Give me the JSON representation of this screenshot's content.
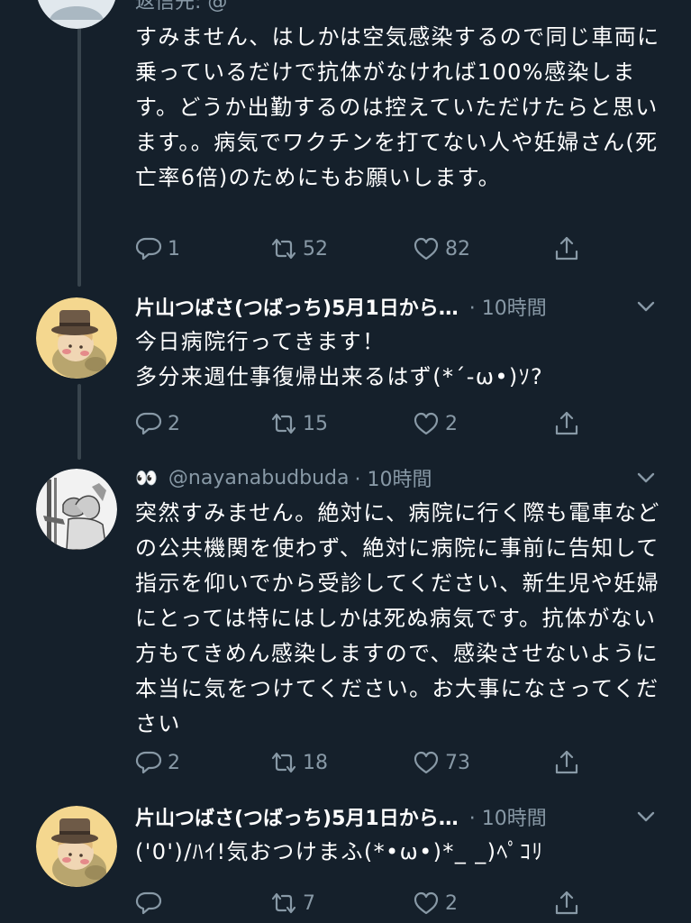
{
  "tweets": [
    {
      "partial_header": "返信先: @",
      "text": "すみません、はしかは空気感染するので同じ車両に乗っているだけで抗体がなければ100%感染します。どうか出勤するのは控えていただけたらと思います。。病気でワクチンを打てない人や妊婦さん(死亡率6倍)のためにもお願いします。",
      "reply_count": "1",
      "retweet_count": "52",
      "like_count": "82"
    },
    {
      "name": "片山つばさ(つばっち)5月1日から…",
      "time": "· 10時間",
      "text": "今日病院行ってきます！\n多分来週仕事復帰出来るはず(*´-ω•)ｿ?",
      "reply_count": "2",
      "retweet_count": "15",
      "like_count": "2"
    },
    {
      "name": "👀",
      "handle": "@nayanabudbuda",
      "time": "· 10時間",
      "text": "突然すみません。絶対に、病院に行く際も電車などの公共機関を使わず、絶対に病院に事前に告知して指示を仰いでから受診してください、新生児や妊婦にとっては特にはしかは死ぬ病気です。抗体がない方もてきめん感染しますので、感染させないように本当に気をつけてください。お大事になさってください",
      "reply_count": "2",
      "retweet_count": "18",
      "like_count": "73"
    },
    {
      "name": "片山つばさ(つばっち)5月1日から…",
      "time": "· 10時間",
      "text": "('0')/ﾊｲ!気おつけまふ(*•ω•)*_ _)ﾍﾟｺﾘ",
      "reply_count": "",
      "retweet_count": "7",
      "like_count": "2"
    }
  ],
  "icons": {
    "reply": "reply-icon",
    "retweet": "retweet-icon",
    "like": "heart-icon",
    "share": "share-icon",
    "more": "chevron-down-icon"
  },
  "colors": {
    "background": "#15202b",
    "secondary_text": "#8899a6",
    "thread_line": "#38444d"
  }
}
